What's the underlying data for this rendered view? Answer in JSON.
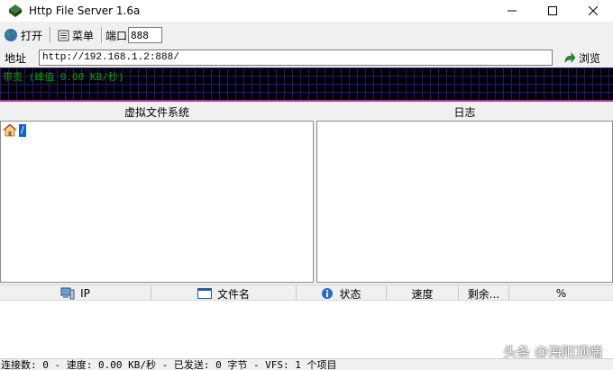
{
  "window": {
    "title": "Http File Server 1.6a"
  },
  "toolbar": {
    "open_label": "打开",
    "menu_label": "菜单",
    "port_label": "端口",
    "port_value": "888"
  },
  "address": {
    "label": "地址",
    "value": "http://192.168.1.2:888/",
    "browse_label": "浏览"
  },
  "bandwidth": {
    "text": "带宽 (峰值 0.00 KB/秒)"
  },
  "vfs": {
    "title": "虚拟文件系统",
    "root_label": "/"
  },
  "log": {
    "title": "日志"
  },
  "connections": {
    "columns": [
      "IP",
      "文件名",
      "状态",
      "速度",
      "剩余...",
      "%"
    ]
  },
  "status": {
    "text": "连接数: 0  -  速度: 0.00 KB/秒  -  已发送: 0 字节  -  VFS: 1 个项目"
  },
  "watermark": {
    "text": "头条 @海阳顶端"
  }
}
